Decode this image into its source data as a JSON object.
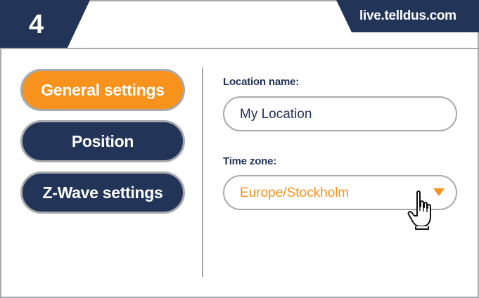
{
  "header": {
    "step_number": "4",
    "url": "live.telldus.com"
  },
  "nav": {
    "items": [
      {
        "label": "General settings",
        "active": true
      },
      {
        "label": "Position",
        "active": false
      },
      {
        "label": "Z-Wave settings",
        "active": false
      }
    ]
  },
  "form": {
    "location": {
      "label": "Location name:",
      "value": "My Location"
    },
    "timezone": {
      "label": "Time zone:",
      "value": "Europe/Stockholm"
    }
  },
  "icons": {
    "dropdown": "triangle-down-icon",
    "cursor": "hand-pointer-icon"
  },
  "colors": {
    "navy": "#233459",
    "accent": "#f7931d",
    "border": "#a7a9ac"
  }
}
